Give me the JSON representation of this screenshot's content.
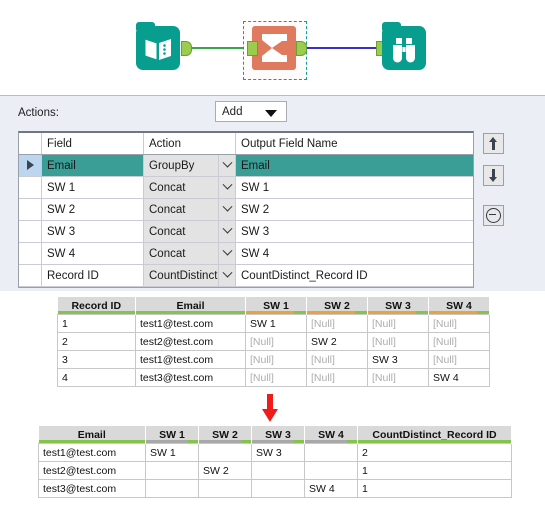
{
  "canvas": {
    "tools": [
      {
        "name": "input-data-tool",
        "icon": "book-icon",
        "label": "Input Data"
      },
      {
        "name": "summarize-tool",
        "icon": "sigma-icon",
        "label": "Summarize",
        "selected": true
      },
      {
        "name": "browse-tool",
        "icon": "binoculars-icon",
        "label": "Browse"
      }
    ],
    "connections": [
      {
        "from": "input-data-tool",
        "to": "summarize-tool",
        "color": "#3aa64a"
      },
      {
        "from": "summarize-tool",
        "to": "browse-tool",
        "color": "#3b2fc9"
      }
    ]
  },
  "config": {
    "actions_label": "Actions:",
    "add_dropdown": {
      "value": "Add",
      "icon": "caret-down-icon"
    },
    "columns": [
      "",
      "Field",
      "Action",
      "Output Field Name"
    ],
    "rows": [
      {
        "selected": true,
        "marker": "▶",
        "field": "Email",
        "action": "GroupBy",
        "output": "Email"
      },
      {
        "selected": false,
        "marker": "",
        "field": "SW 1",
        "action": "Concat",
        "output": "SW 1"
      },
      {
        "selected": false,
        "marker": "",
        "field": "SW 2",
        "action": "Concat",
        "output": "SW 2"
      },
      {
        "selected": false,
        "marker": "",
        "field": "SW 3",
        "action": "Concat",
        "output": "SW 3"
      },
      {
        "selected": false,
        "marker": "",
        "field": "SW 4",
        "action": "Concat",
        "output": "SW 4"
      },
      {
        "selected": false,
        "marker": "",
        "field": "Record ID",
        "action": "CountDistinct",
        "output": "CountDistinct_Record ID"
      }
    ],
    "side_buttons": [
      {
        "name": "move-up-button",
        "icon": "arrow-up-icon"
      },
      {
        "name": "move-down-button",
        "icon": "arrow-down-icon"
      },
      {
        "name": "remove-button",
        "icon": "minus-circle-icon"
      }
    ],
    "selection_color": "#3a9e96"
  },
  "input_table": {
    "headers": [
      "Record ID",
      "Email",
      "SW 1",
      "SW 2",
      "SW 3",
      "SW 4"
    ],
    "header_bar_colors": [
      "#84c44a",
      "#84c44a",
      "#e8a33d",
      "#e8a33d",
      "#e8a33d",
      "#e8a33d"
    ],
    "null_text": "[Null]",
    "rows": [
      [
        "1",
        "test1@test.com",
        "SW 1",
        "[Null]",
        "[Null]",
        "[Null]"
      ],
      [
        "2",
        "test2@test.com",
        "[Null]",
        "SW 2",
        "[Null]",
        "[Null]"
      ],
      [
        "3",
        "test1@test.com",
        "[Null]",
        "[Null]",
        "SW 3",
        "[Null]"
      ],
      [
        "4",
        "test3@test.com",
        "[Null]",
        "[Null]",
        "[Null]",
        "SW 4"
      ]
    ]
  },
  "arrow": {
    "name": "flow-arrow-down",
    "color": "#ef1c1c"
  },
  "output_table": {
    "headers": [
      "Email",
      "SW 1",
      "SW 2",
      "SW 3",
      "SW 4",
      "CountDistinct_Record ID"
    ],
    "header_bar_colors": [
      "#84c44a",
      "#a8a8a8",
      "#a8a8a8",
      "#a8a8a8",
      "#a8a8a8",
      "#84c44a"
    ],
    "rows": [
      [
        "test1@test.com",
        "SW 1",
        "",
        "SW 3",
        "",
        "2"
      ],
      [
        "test2@test.com",
        "",
        "SW 2",
        "",
        "",
        "1"
      ],
      [
        "test3@test.com",
        "",
        "",
        "",
        "SW 4",
        "1"
      ]
    ]
  }
}
